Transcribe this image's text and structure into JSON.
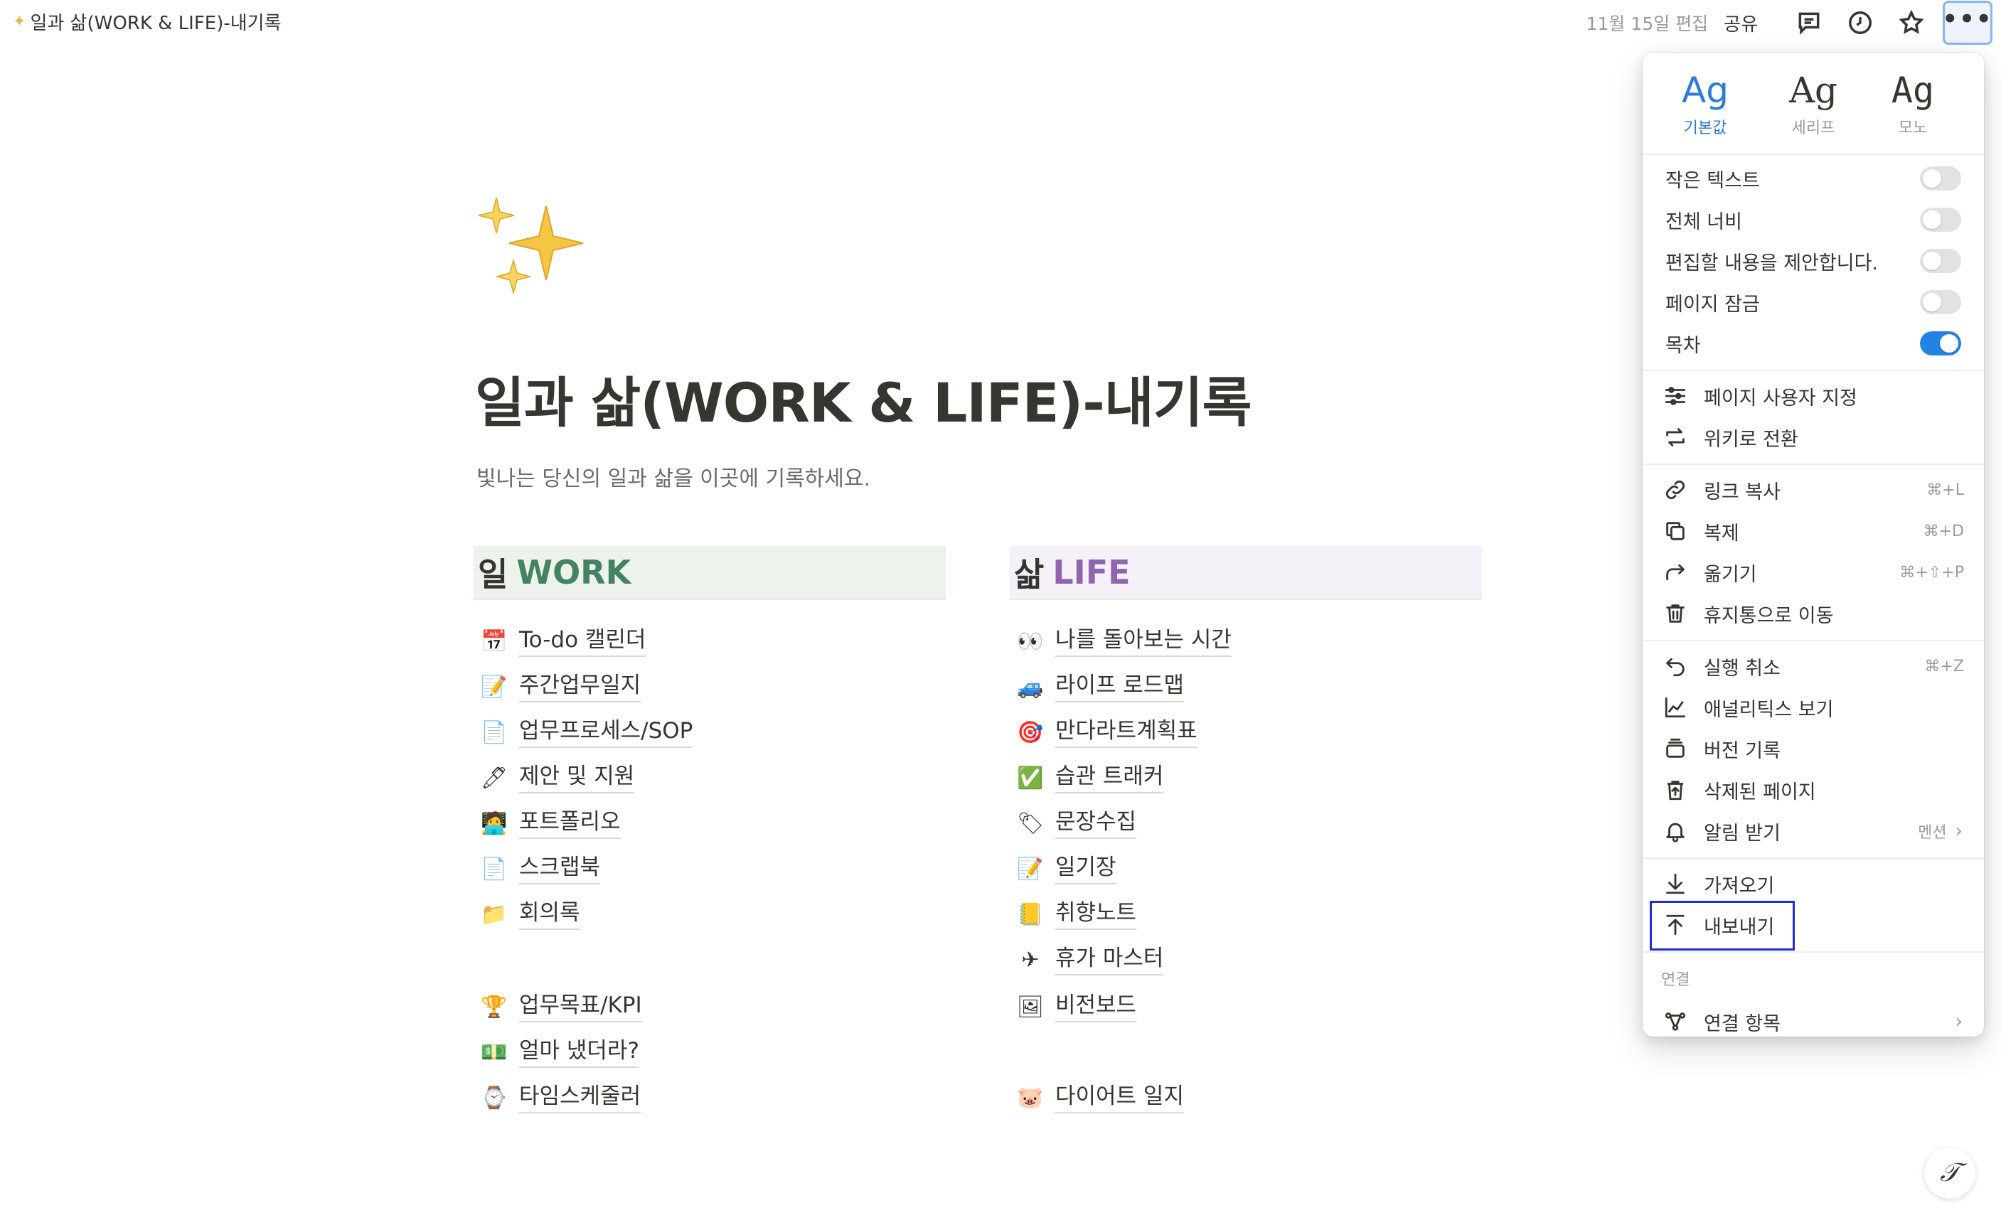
{
  "topbar": {
    "breadcrumb": "일과 삶(WORK & LIFE)-내기록",
    "edited": "11월 15일 편집",
    "share": "공유"
  },
  "page": {
    "title": "일과 삶(WORK & LIFE)-내기록",
    "description": "빛나는 당신의 일과 삶을 이곳에 기록하세요."
  },
  "work": {
    "heading_ko": "일",
    "heading_en": "WORK",
    "items": [
      "To-do 캘린더",
      "주간업무일지",
      "업무프로세스/SOP",
      "제안 및 지원",
      "포트폴리오",
      "스크랩북",
      "회의록",
      "업무목표/KPI",
      "얼마 냈더라?",
      "타임스케줄러"
    ]
  },
  "life": {
    "heading_ko": "삶",
    "heading_en": "LIFE",
    "items": [
      "나를 돌아보는 시간",
      "라이프 로드맵",
      "만다라트계획표",
      "습관 트래커",
      "문장수집",
      "일기장",
      "취향노트",
      "휴가 마스터",
      "비전보드",
      "다이어트 일지"
    ]
  },
  "menu": {
    "fonts": [
      {
        "sample": "Ag",
        "label": "기본값"
      },
      {
        "sample": "Ag",
        "label": "세리프"
      },
      {
        "sample": "Ag",
        "label": "모노"
      }
    ],
    "toggles": [
      {
        "label": "작은 텍스트",
        "on": false
      },
      {
        "label": "전체 너비",
        "on": false
      },
      {
        "label": "편집할 내용을 제안합니다.",
        "on": false
      },
      {
        "label": "페이지 잠금",
        "on": false
      },
      {
        "label": "목차",
        "on": true
      }
    ],
    "group1": [
      {
        "label": "페이지 사용자 지정",
        "icon": "sliders-icon"
      },
      {
        "label": "위키로 전환",
        "icon": "convert-icon"
      }
    ],
    "group2": [
      {
        "label": "링크 복사",
        "shortcut": "⌘+L",
        "icon": "link-icon"
      },
      {
        "label": "복제",
        "shortcut": "⌘+D",
        "icon": "duplicate-icon"
      },
      {
        "label": "옮기기",
        "shortcut": "⌘+⇧+P",
        "icon": "move-icon"
      },
      {
        "label": "휴지통으로 이동",
        "shortcut": "",
        "icon": "trash-icon"
      }
    ],
    "group3": [
      {
        "label": "실행 취소",
        "shortcut": "⌘+Z",
        "icon": "undo-icon"
      },
      {
        "label": "애널리틱스 보기",
        "shortcut": "",
        "icon": "analytics-icon"
      },
      {
        "label": "버전 기록",
        "shortcut": "",
        "icon": "version-icon"
      },
      {
        "label": "삭제된 페이지",
        "shortcut": "",
        "icon": "deleted-icon"
      },
      {
        "label": "알림 받기",
        "shortcut": "멘션",
        "icon": "bell-icon"
      }
    ],
    "group4": [
      {
        "label": "가져오기",
        "icon": "import-icon"
      },
      {
        "label": "내보내기",
        "icon": "export-icon"
      }
    ],
    "connections_label": "연결",
    "connections_item": "연결 항목"
  },
  "colors": {
    "accent": "#2383e2",
    "work_heading": "#448361",
    "life_heading": "#9065b0",
    "highlight_box": "#1f2fd6"
  }
}
